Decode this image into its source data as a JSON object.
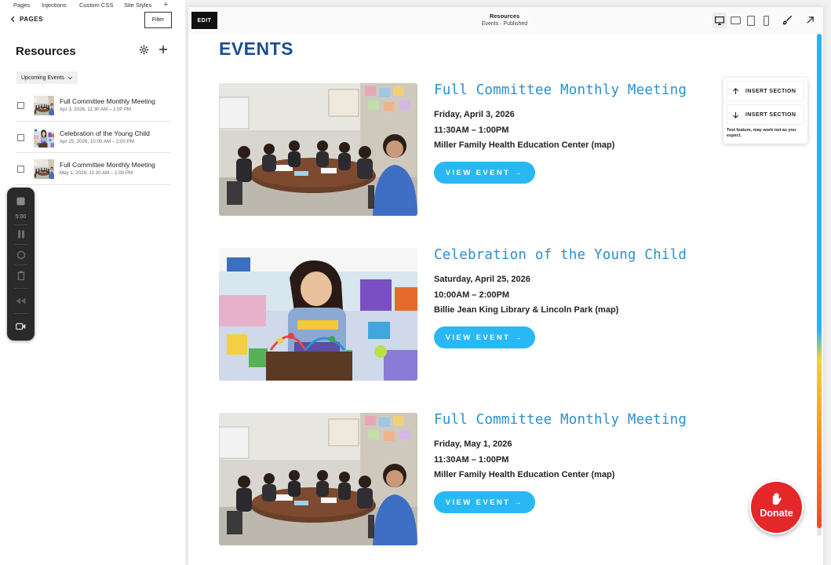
{
  "editor": {
    "tabs": [
      {
        "label": "Pages"
      },
      {
        "label": "Injections"
      },
      {
        "label": "Custom CSS"
      },
      {
        "label": "Site Styles"
      }
    ],
    "add_tab_symbol": "+",
    "back_label": "PAGES",
    "filter_label": "Filter",
    "panel_title": "Resources",
    "dropdown_value": "Upcoming Events",
    "items": [
      {
        "name": "Full Committee Monthly Meeting",
        "date": "Apr 3, 2026, 11:30 AM – 1:00 PM"
      },
      {
        "name": "Celebration of the Young Child",
        "date": "Apr 25, 2026, 10:00 AM – 2:00 PM"
      },
      {
        "name": "Full Committee Monthly Meeting",
        "date": "May 1, 2026, 11:30 AM – 1:00 PM"
      }
    ]
  },
  "recorder": {
    "time": "5:00"
  },
  "preview": {
    "edit_label": "EDIT",
    "page_title": "Resources",
    "page_status": "Events · Published",
    "heading": "EVENTS",
    "events": [
      {
        "title": "Full Committee Monthly Meeting",
        "date": "Friday, April 3, 2026",
        "time": "11:30AM – 1:00PM",
        "location": "Miller Family Health Education Center (map)",
        "button": "VIEW EVENT →"
      },
      {
        "title": "Celebration of the Young Child",
        "date": "Saturday, April 25, 2026",
        "time": "10:00AM – 2:00PM",
        "location": "Billie Jean King Library & Lincoln Park (map)",
        "button": "VIEW EVENT →"
      },
      {
        "title": "Full Committee Monthly Meeting",
        "date": "Friday, May 1, 2026",
        "time": "11:30AM – 1:00PM",
        "location": "Miller Family Health Education Center (map)",
        "button": "VIEW EVENT →"
      }
    ]
  },
  "insert_popup": {
    "insert_above": "INSERT SECTION",
    "insert_below": "INSERT SECTION",
    "note": "Test feature, may work not as you expect."
  },
  "donate_label": "Donate",
  "colors": {
    "heading": "#1e4f93",
    "event_title": "#2a8fd0",
    "button": "#29b8f3",
    "donate": "#e4282a"
  }
}
